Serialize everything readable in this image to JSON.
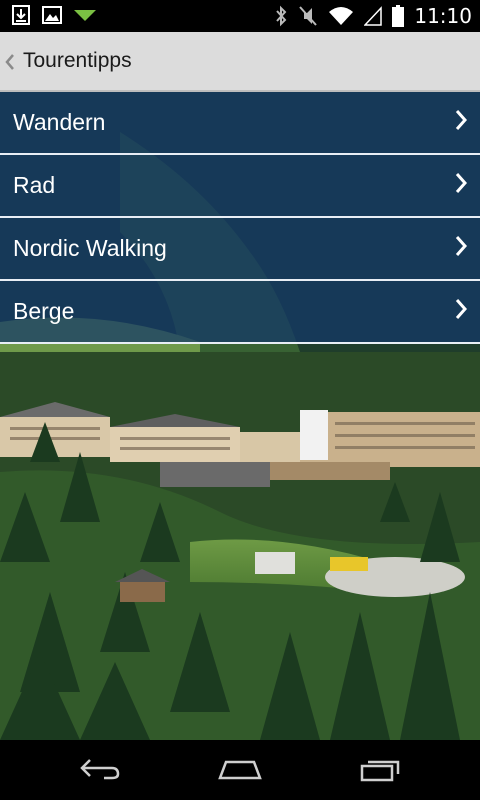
{
  "status_bar": {
    "time": "11:10",
    "left_icons": [
      "download-icon",
      "image-icon",
      "signal-arrow-icon"
    ],
    "right_icons": [
      "bluetooth-icon",
      "mute-icon",
      "wifi-icon",
      "cell-signal-icon",
      "battery-icon"
    ]
  },
  "action_bar": {
    "title": "Tourentipps"
  },
  "menu": {
    "items": [
      {
        "label": "Wandern"
      },
      {
        "label": "Rad"
      },
      {
        "label": "Nordic Walking"
      },
      {
        "label": "Berge"
      }
    ]
  },
  "nav_bar": {
    "buttons": [
      "back-icon",
      "home-icon",
      "recents-icon"
    ]
  },
  "colors": {
    "menu_overlay": "#143769",
    "action_bar_bg": "#dcdcdc"
  }
}
